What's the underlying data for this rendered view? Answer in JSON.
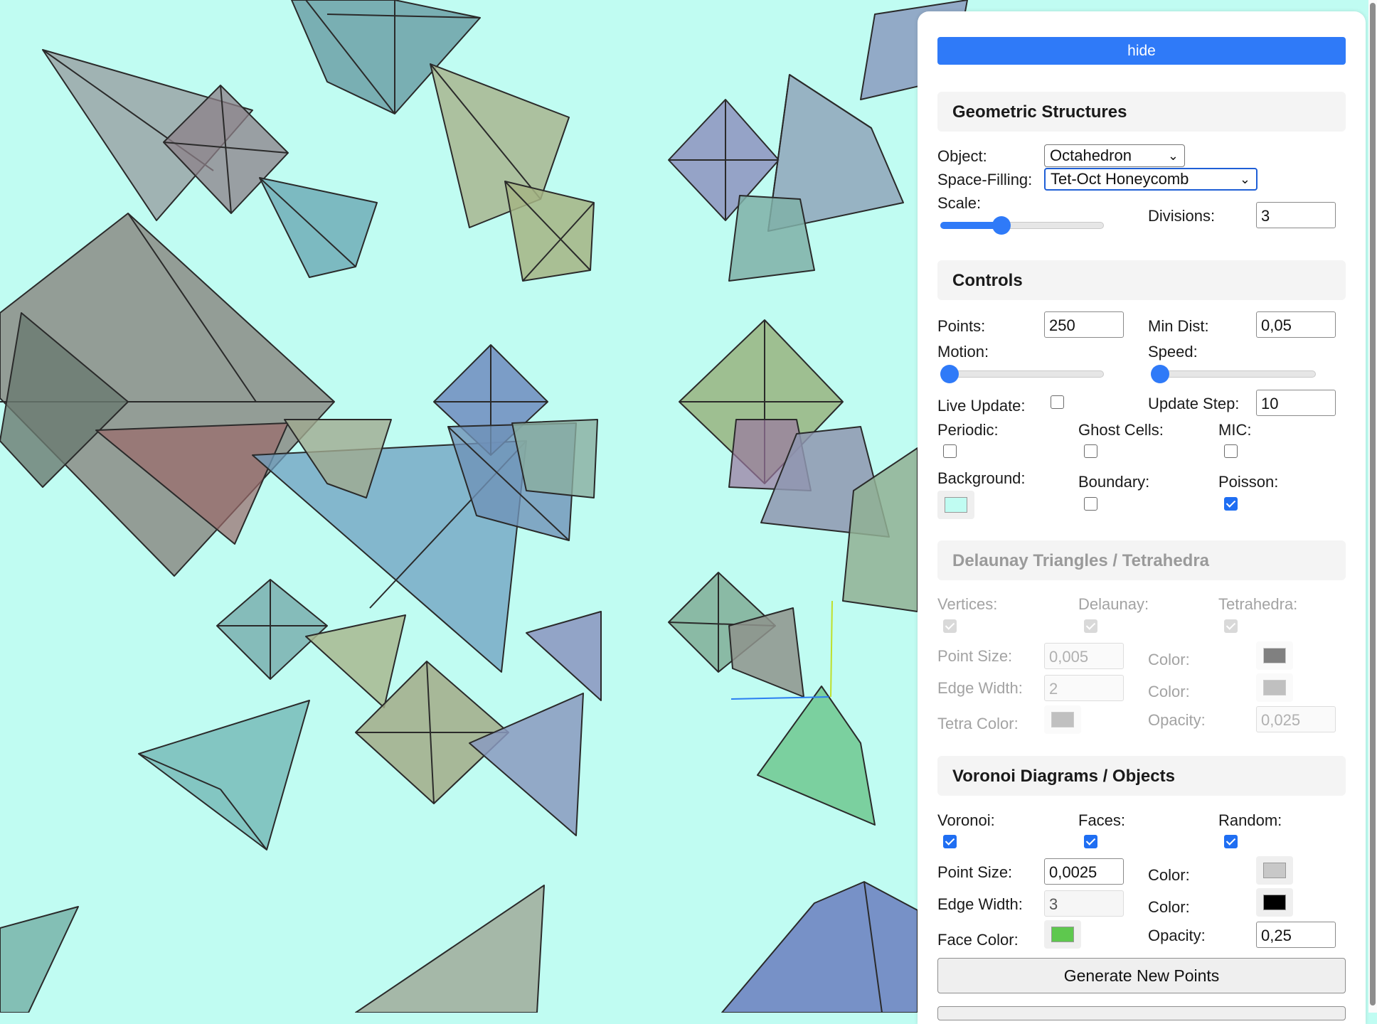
{
  "panel": {
    "hide_label": "hide",
    "geometric": {
      "title": "Geometric Structures",
      "object_label": "Object:",
      "object_value": "Octahedron",
      "space_filling_label": "Space-Filling:",
      "space_filling_value": "Tet-Oct Honeycomb",
      "scale_label": "Scale:",
      "scale_value": 0.3,
      "divisions_label": "Divisions:",
      "divisions_value": "3"
    },
    "controls": {
      "title": "Controls",
      "points_label": "Points:",
      "points_value": "250",
      "min_dist_label": "Min Dist:",
      "min_dist_value": "0,05",
      "motion_label": "Motion:",
      "motion_value": 0,
      "speed_label": "Speed:",
      "speed_value": 0,
      "live_update_label": "Live Update:",
      "update_step_label": "Update Step:",
      "update_step_value": "10",
      "periodic_label": "Periodic:",
      "ghost_cells_label": "Ghost Cells:",
      "mic_label": "MIC:",
      "background_label": "Background:",
      "boundary_label": "Boundary:",
      "poisson_label": "Poisson:",
      "background_color": "#c0fcf2"
    },
    "delaunay": {
      "title": "Delaunay Triangles / Tetrahedra",
      "vertices_label": "Vertices:",
      "delaunay_label": "Delaunay:",
      "tetrahedra_label": "Tetrahedra:",
      "point_size_label": "Point Size:",
      "point_size_value": "0,005",
      "color_label_1": "Color:",
      "edge_width_label": "Edge Width:",
      "edge_width_value": "2",
      "color_label_2": "Color:",
      "tetra_color_label": "Tetra Color:",
      "opacity_label": "Opacity:",
      "opacity_value": "0,025",
      "point_color": "#808080",
      "edge_color": "#c0c0c0",
      "tetra_color": "#c0c0c0"
    },
    "voronoi": {
      "title": "Voronoi Diagrams / Objects",
      "voronoi_label": "Voronoi:",
      "faces_label": "Faces:",
      "random_label": "Random:",
      "point_size_label": "Point Size:",
      "point_size_value": "0,0025",
      "color_label_1": "Color:",
      "edge_width_label": "Edge Width:",
      "edge_width_value": "3",
      "color_label_2": "Color:",
      "face_color_label": "Face Color:",
      "opacity_label": "Opacity:",
      "opacity_value": "0,25",
      "point_color": "#c8c8c8",
      "edge_color": "#000000",
      "face_color": "#5ec84e"
    },
    "generate_label": "Generate New Points"
  }
}
